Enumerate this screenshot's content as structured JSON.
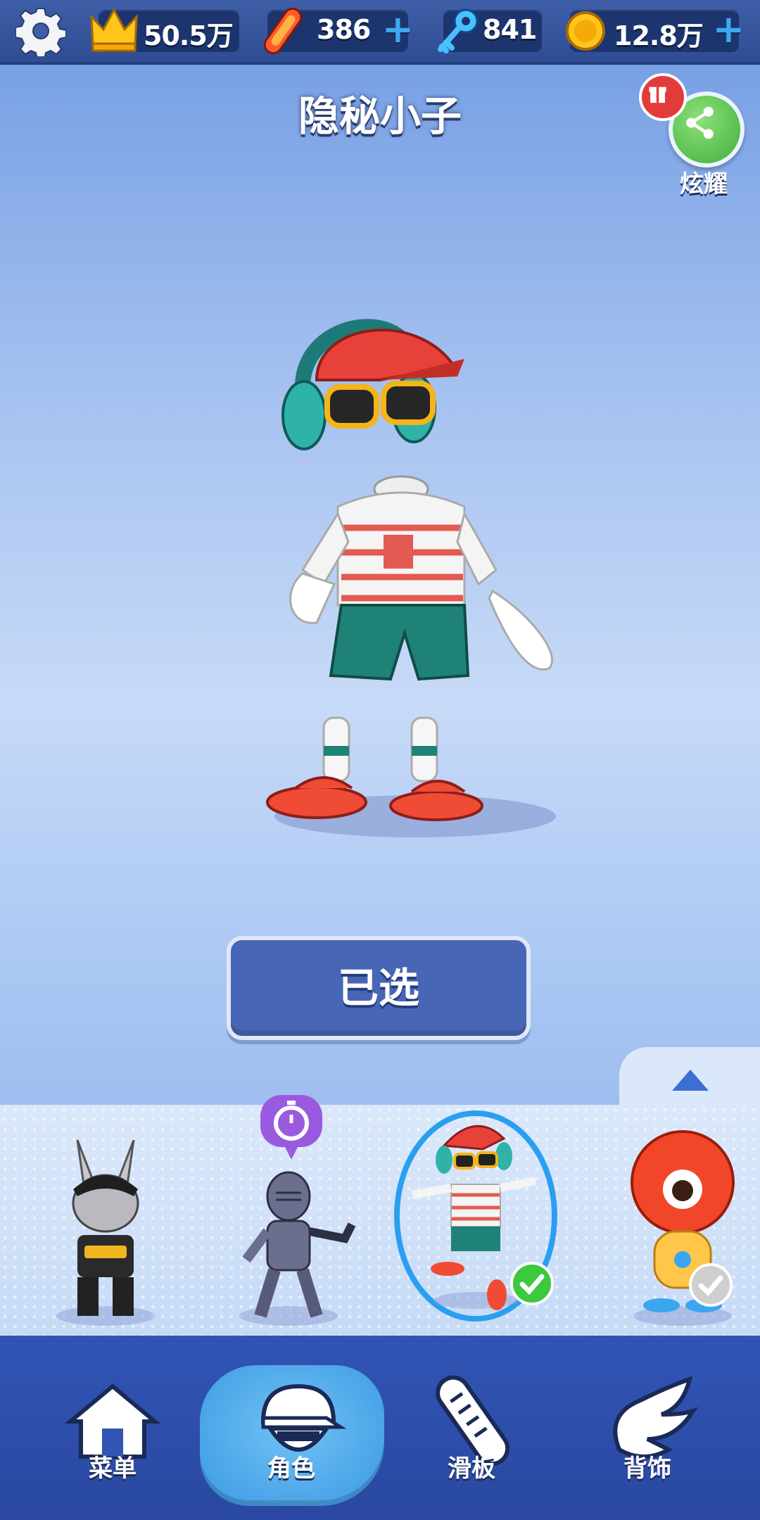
{
  "resources": {
    "crowns": "50.5万",
    "hoverboards": "386",
    "keys": "841",
    "coins": "12.8万"
  },
  "character_name": "隐秘小子",
  "share_label": "炫耀",
  "select_button": "已选",
  "nav": {
    "menu": "菜单",
    "character": "角色",
    "board": "滑板",
    "accessory": "背饰"
  },
  "colors": {
    "accent": "#4866b6",
    "nav": "#3154b5",
    "selected_check": "#3cc83f"
  }
}
